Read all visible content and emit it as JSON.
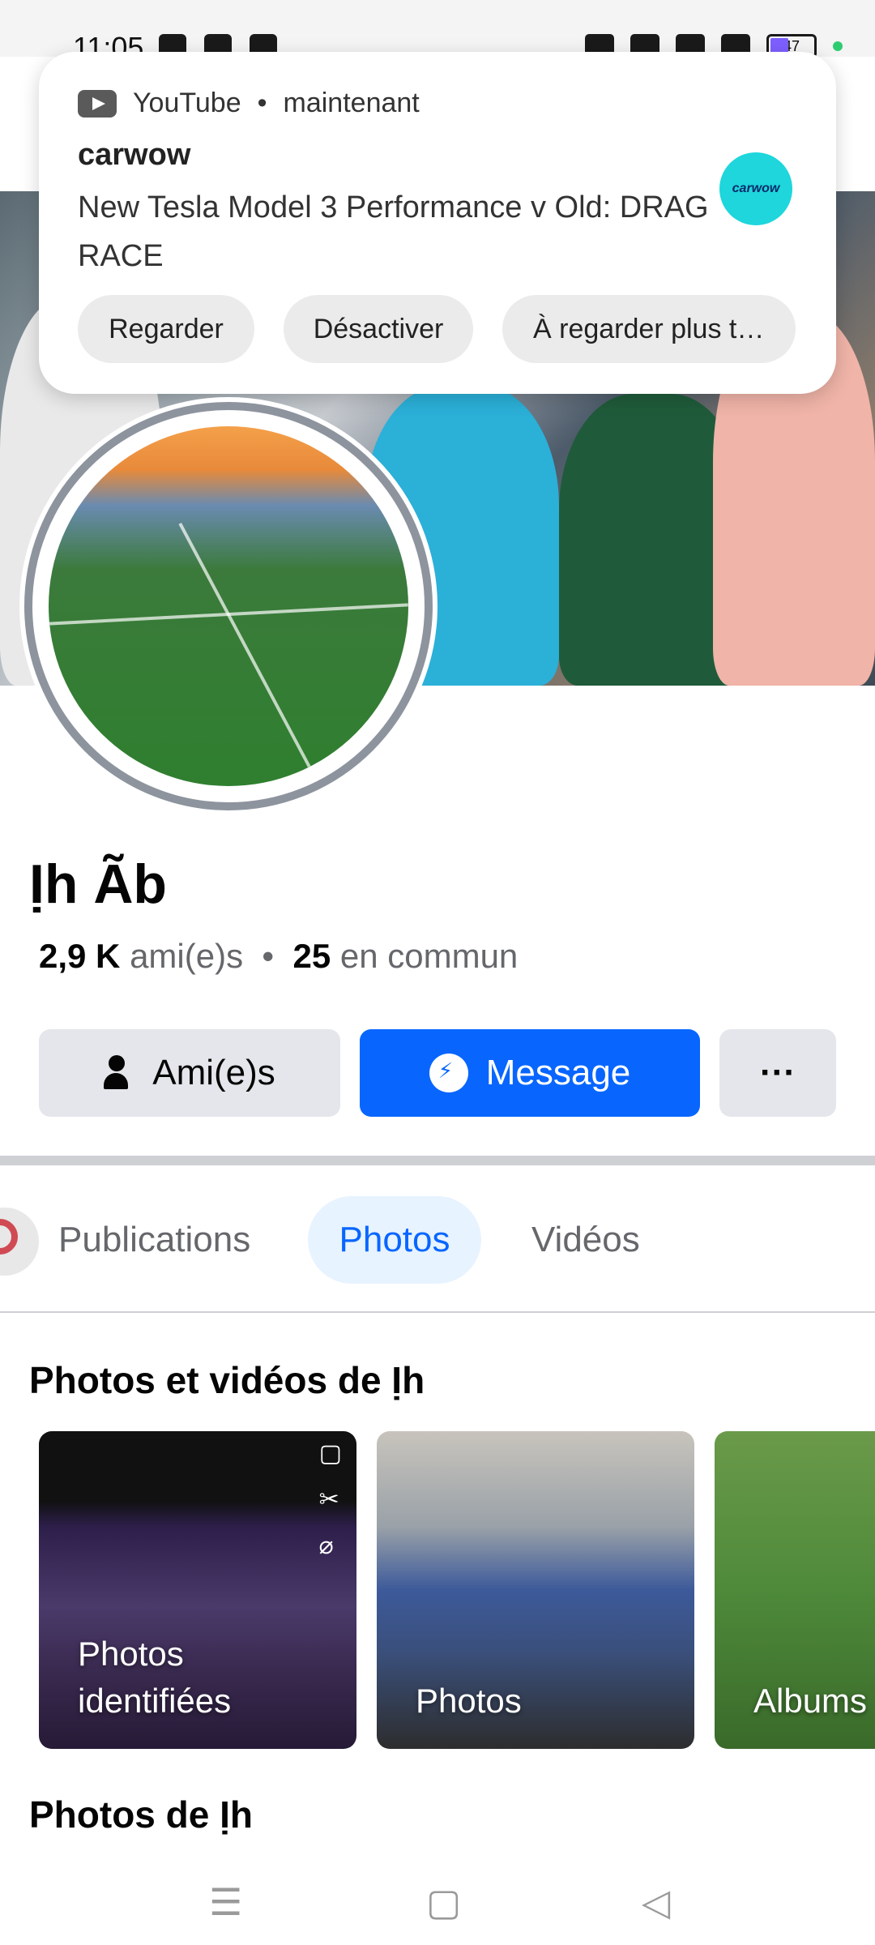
{
  "status_bar": {
    "time": "11:05",
    "battery": "47"
  },
  "notification": {
    "app": "YouTube",
    "when": "maintenant",
    "title": "carwow",
    "body": "New Tesla Model 3 Performance v Old: DRAG RACE",
    "avatar_text": "carwow",
    "actions": [
      "Regarder",
      "Désactiver",
      "À regarder plus t…"
    ]
  },
  "profile": {
    "name": "Ịh Ãb",
    "friends_count": "2,9 K",
    "friends_label": "ami(e)s",
    "mutual_count": "25",
    "mutual_label": "en commun"
  },
  "buttons": {
    "friends": "Ami(e)s",
    "message": "Message",
    "more": "···"
  },
  "tabs": [
    "Publications",
    "Photos",
    "Vidéos"
  ],
  "section_photos_videos": "Photos et vidéos de Ịh",
  "cards": [
    {
      "label_line1": "Photos",
      "label_line2": "identifiées"
    },
    {
      "label_line1": "Photos"
    },
    {
      "label_line1": "Albums"
    }
  ],
  "section_photos": "Photos de Ịh",
  "colors": {
    "primary": "#0866ff",
    "tab_active_bg": "#e7f3ff",
    "button_grey": "#e4e6eb",
    "secondary_text": "#65676b"
  }
}
